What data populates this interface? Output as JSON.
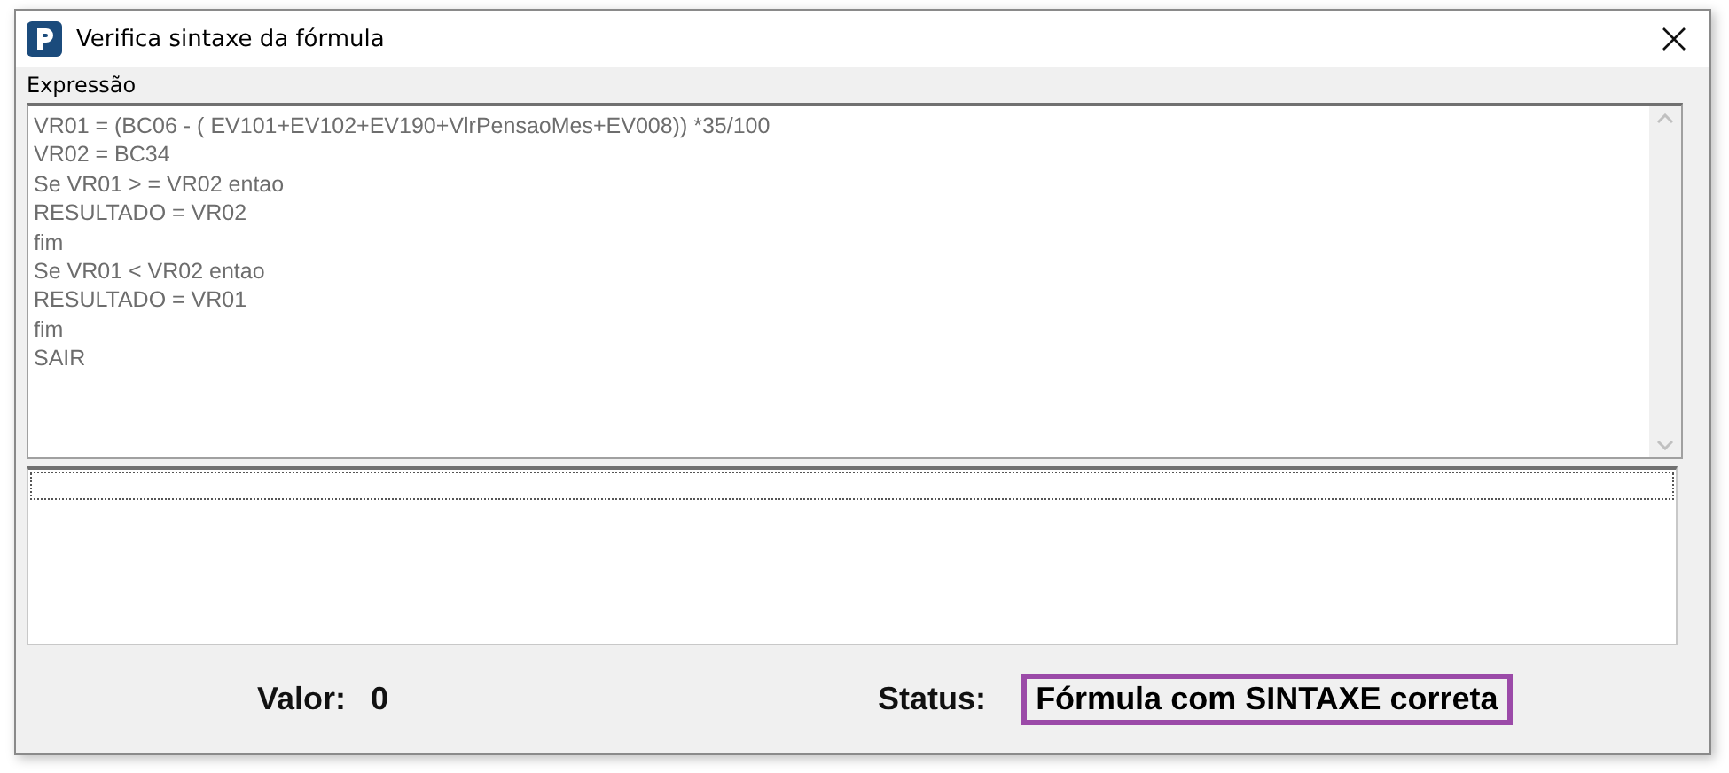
{
  "window": {
    "title": "Verifica sintaxe da fórmula"
  },
  "expression": {
    "label": "Expressão",
    "lines": [
      "VR01 = (BC06 - ( EV101+EV102+EV190+VlrPensaoMes+EV008)) *35/100",
      "VR02 = BC34",
      "Se VR01 > = VR02 entao",
      "RESULTADO = VR02",
      "fim",
      "Se VR01 < VR02 entao",
      "RESULTADO = VR01",
      "fim",
      "SAIR"
    ]
  },
  "value": {
    "label": "Valor:",
    "text": "0"
  },
  "status": {
    "label": "Status:",
    "text": "Fórmula com SINTAXE correta"
  }
}
